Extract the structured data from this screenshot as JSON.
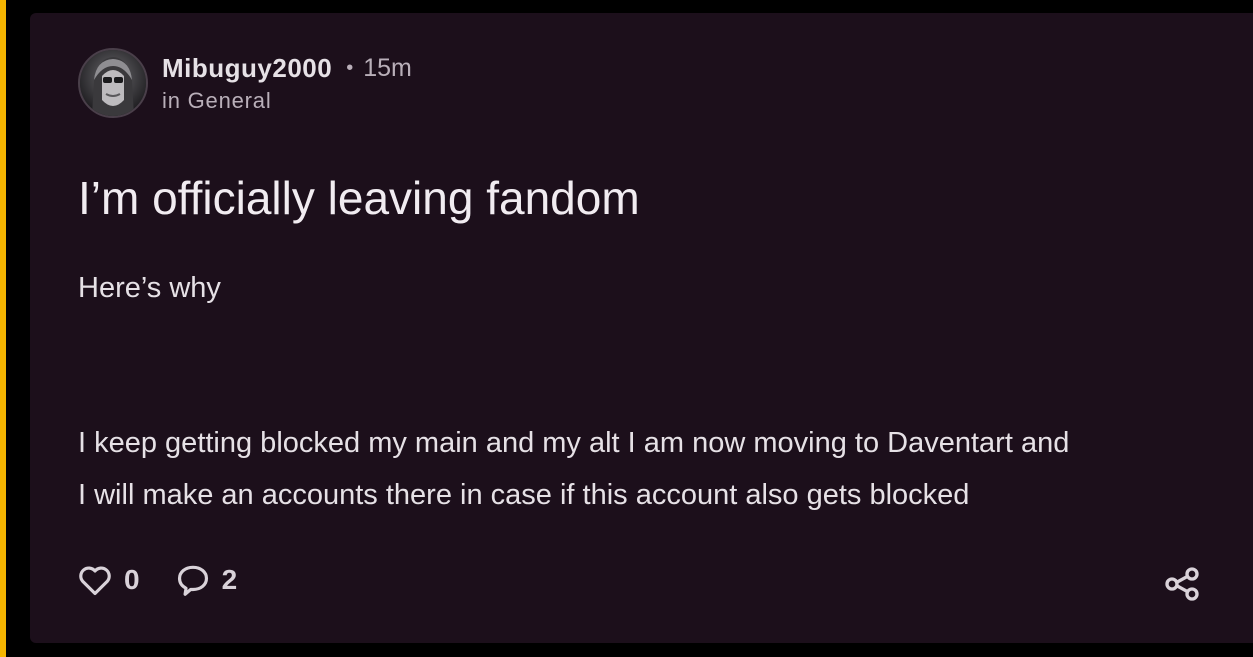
{
  "colors": {
    "accent": "#f5b400",
    "card_background": "#1c0f1b",
    "text_primary": "#f1ecf1",
    "text_muted": "#b9afb9"
  },
  "post": {
    "author": "Mibuguy2000",
    "separator": "•",
    "time": "15m",
    "community": "in General",
    "title": "I’m officially leaving fandom",
    "body": [
      "Here’s why",
      "I keep getting blocked my main and my alt I am now moving to Daventart and",
      "I will make an accounts there in case if this account also gets blocked"
    ]
  },
  "actions": {
    "likes": "0",
    "comments": "2",
    "icons": {
      "like": "heart-icon",
      "comment": "comment-bubble-icon",
      "share": "share-icon"
    }
  }
}
